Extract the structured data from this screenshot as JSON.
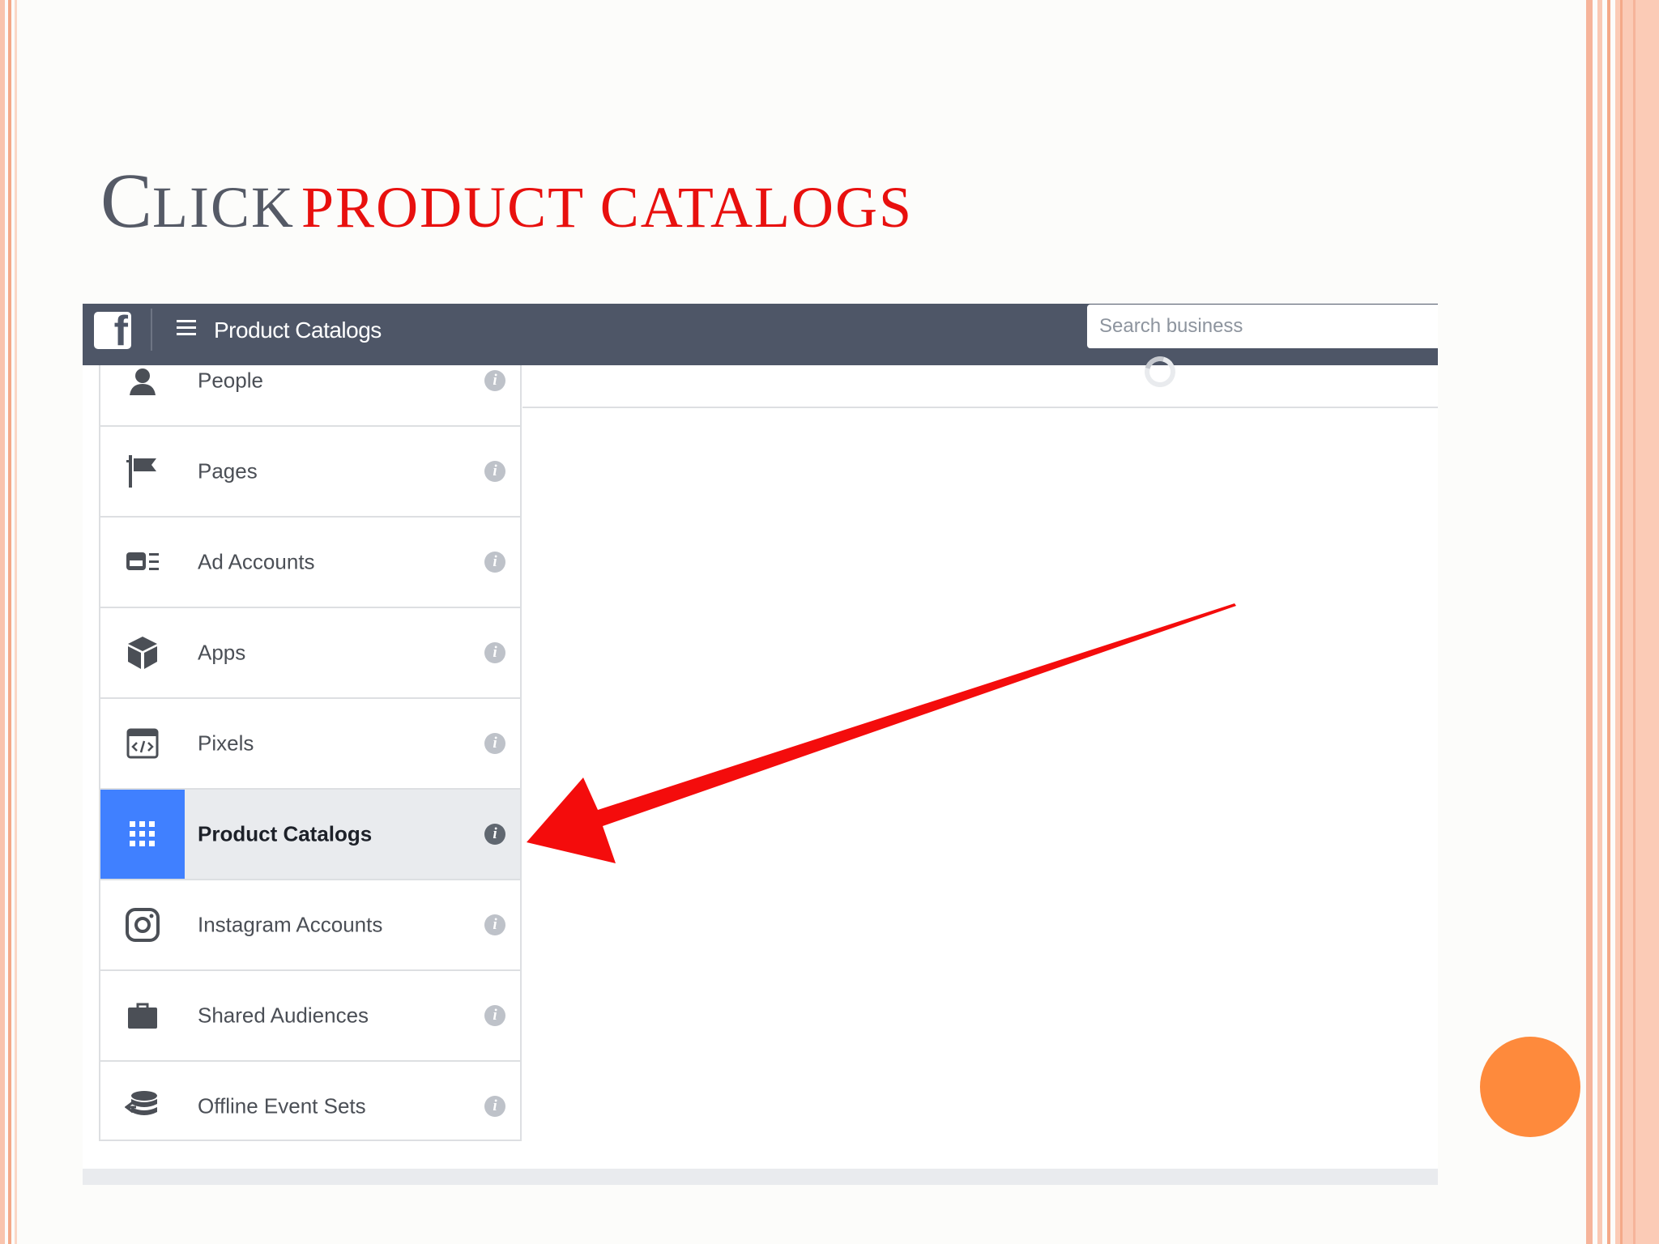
{
  "slide": {
    "title_cap": "C",
    "title_rest": "lick",
    "title_highlight": "product catalogs",
    "accent_color": "#e8100e",
    "circle_color": "#fe8a3c"
  },
  "topbar": {
    "logo_letter": "f",
    "title": "Product Catalogs",
    "search_placeholder": "Search business"
  },
  "sidebar": {
    "items": [
      {
        "label": "People",
        "icon": "person-icon",
        "active": false
      },
      {
        "label": "Pages",
        "icon": "flag-icon",
        "active": false
      },
      {
        "label": "Ad Accounts",
        "icon": "ad-account-icon",
        "active": false
      },
      {
        "label": "Apps",
        "icon": "cube-icon",
        "active": false
      },
      {
        "label": "Pixels",
        "icon": "code-window-icon",
        "active": false
      },
      {
        "label": "Product Catalogs",
        "icon": "grid-icon",
        "active": true
      },
      {
        "label": "Instagram Accounts",
        "icon": "instagram-icon",
        "active": false
      },
      {
        "label": "Shared Audiences",
        "icon": "briefcase-icon",
        "active": false
      },
      {
        "label": "Offline Event Sets",
        "icon": "database-sync-icon",
        "active": false
      }
    ],
    "info_glyph": "i"
  }
}
